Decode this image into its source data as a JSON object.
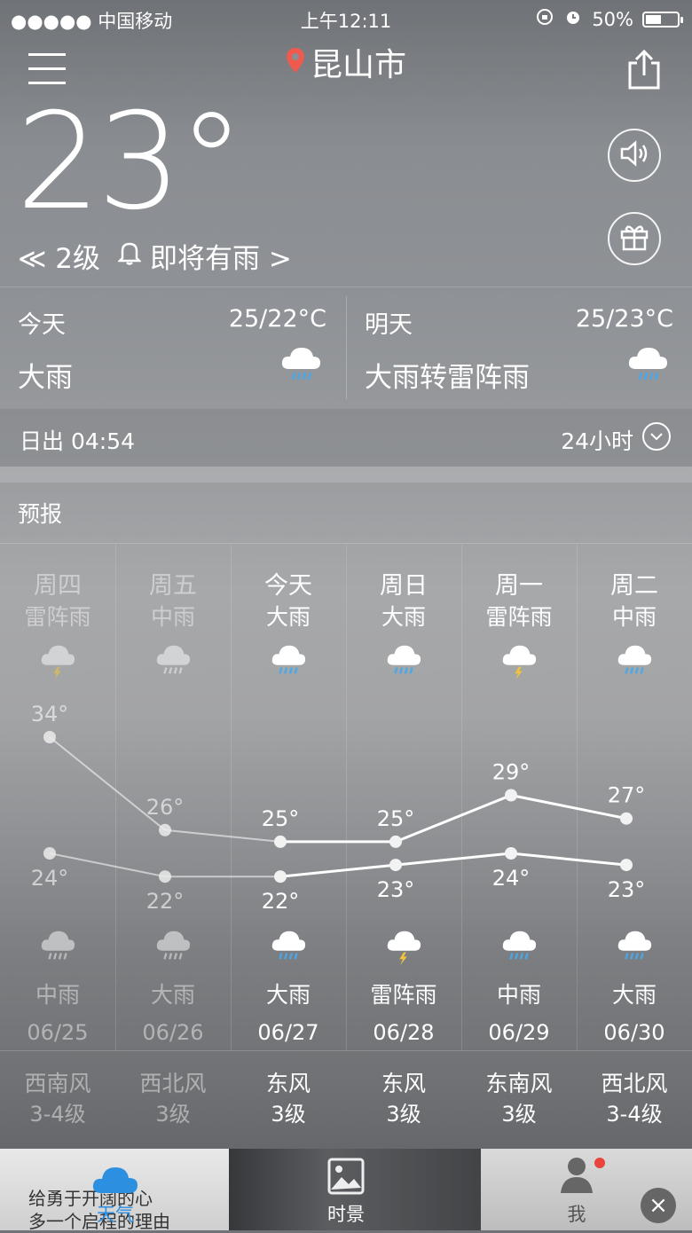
{
  "status": {
    "carrier": "●●●●● 中国移动",
    "time": "上午12:11",
    "battery": "50%",
    "battery_level": 0.5
  },
  "header": {
    "city": "昆山市",
    "temperature": "23°",
    "wind": "≪ 2级",
    "alert": "即将有雨 >"
  },
  "today": {
    "label": "今天",
    "range": "25/22°C",
    "condition": "大雨",
    "icon": "rain-cloud-icon"
  },
  "tomorrow": {
    "label": "明天",
    "range": "25/23°C",
    "condition": "大雨转雷阵雨",
    "icon": "rain-cloud-icon"
  },
  "sun": {
    "sunrise": "日出 04:54",
    "hours_label": "24小时"
  },
  "forecast_label": "预报",
  "forecast": [
    {
      "day": "周四",
      "day_weather": "雷阵雨",
      "night_weather": "中雨",
      "date": "06/25",
      "high": "34°",
      "low": "24°",
      "wind_dir": "西南风",
      "wind_level": "3-4级",
      "past": true,
      "day_icon": "thunder-cloud-icon",
      "night_icon": "rain-cloud-icon"
    },
    {
      "day": "周五",
      "day_weather": "中雨",
      "night_weather": "大雨",
      "date": "06/26",
      "high": "26°",
      "low": "22°",
      "wind_dir": "西北风",
      "wind_level": "3级",
      "past": true,
      "day_icon": "rain-cloud-icon",
      "night_icon": "rain-cloud-icon"
    },
    {
      "day": "今天",
      "day_weather": "大雨",
      "night_weather": "大雨",
      "date": "06/27",
      "high": "25°",
      "low": "22°",
      "wind_dir": "东风",
      "wind_level": "3级",
      "past": false,
      "day_icon": "rain-cloud-icon",
      "night_icon": "rain-cloud-icon"
    },
    {
      "day": "周日",
      "day_weather": "大雨",
      "night_weather": "雷阵雨",
      "date": "06/28",
      "high": "25°",
      "low": "23°",
      "wind_dir": "东风",
      "wind_level": "3级",
      "past": false,
      "day_icon": "rain-cloud-icon",
      "night_icon": "thunder-cloud-icon"
    },
    {
      "day": "周一",
      "day_weather": "雷阵雨",
      "night_weather": "中雨",
      "date": "06/29",
      "high": "29°",
      "low": "24°",
      "wind_dir": "东南风",
      "wind_level": "3级",
      "past": false,
      "day_icon": "thunder-cloud-icon",
      "night_icon": "rain-cloud-icon"
    },
    {
      "day": "周二",
      "day_weather": "中雨",
      "night_weather": "大雨",
      "date": "06/30",
      "high": "27°",
      "low": "23°",
      "wind_dir": "西北风",
      "wind_level": "3-4级",
      "past": false,
      "day_icon": "rain-cloud-icon",
      "night_icon": "rain-cloud-icon"
    }
  ],
  "chart_data": {
    "type": "line",
    "categories": [
      "06/25",
      "06/26",
      "06/27",
      "06/28",
      "06/29",
      "06/30"
    ],
    "series": [
      {
        "values": [
          34,
          26,
          25,
          25,
          29,
          27
        ]
      },
      {
        "values": [
          24,
          22,
          22,
          23,
          24,
          23
        ]
      }
    ]
  },
  "tabs": [
    {
      "label": "天气",
      "icon": "cloud-icon"
    },
    {
      "label": "时景",
      "icon": "picture-icon"
    },
    {
      "label": "我",
      "icon": "person-icon"
    }
  ],
  "ad": {
    "line1": "给勇于开阔的心",
    "line2": "多一个启程的理由"
  },
  "colors": {
    "pin": "#ef5a4f",
    "tab_active": "#2d8fe0",
    "rain_drop": "#4aa8e8",
    "thunder": "#f2c33a"
  }
}
